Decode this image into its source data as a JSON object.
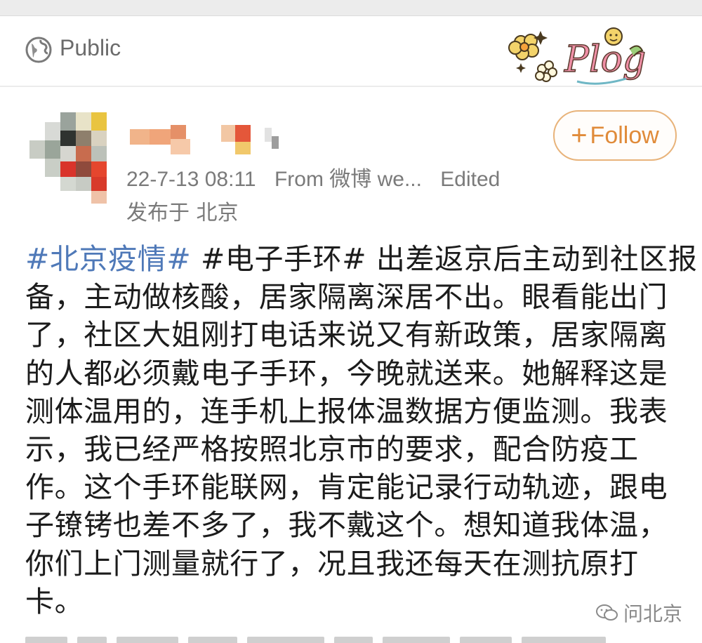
{
  "header": {
    "visibility_icon": "globe-icon",
    "visibility_label": "Public",
    "sticker": "plog-sticker",
    "sticker_text": "Plog"
  },
  "author": {
    "avatar": "pixelated-avatar",
    "name_hidden": true,
    "timestamp": "22-7-13 08:11",
    "source": "From 微博 we...",
    "edited": "Edited",
    "location": "发布于 北京"
  },
  "follow_button": {
    "plus": "+",
    "label": "Follow",
    "color": "#e08b3a"
  },
  "post": {
    "hashtag_link": "#北京疫情#",
    "hashtag_color": "#4f79b8",
    "hashtag_plain": "#电子手环#",
    "lines": [
      "出差返京后主动到社区报",
      "备，主动做核酸，居家隔离深居不出。眼看能出门",
      "了，社区大姐刚打电话来说又有新政策，居家隔离",
      "的人都必须戴电子手环，今晚就送来。她解释这是",
      "测体温用的，连手机上报体温数据方便监测。我表",
      "示，我已经严格按照北京市的要求，配合防疫工",
      "作。这个手环能联网，肯定能记录行动轨迹，跟电",
      "子镣铐也差不多了，我不戴这个。想知道我体温，",
      "你们上门测量就行了，况且我还每天在测抗原打",
      "卡。"
    ]
  },
  "watermark": {
    "icon": "wechat-icon",
    "text": "问北京"
  }
}
